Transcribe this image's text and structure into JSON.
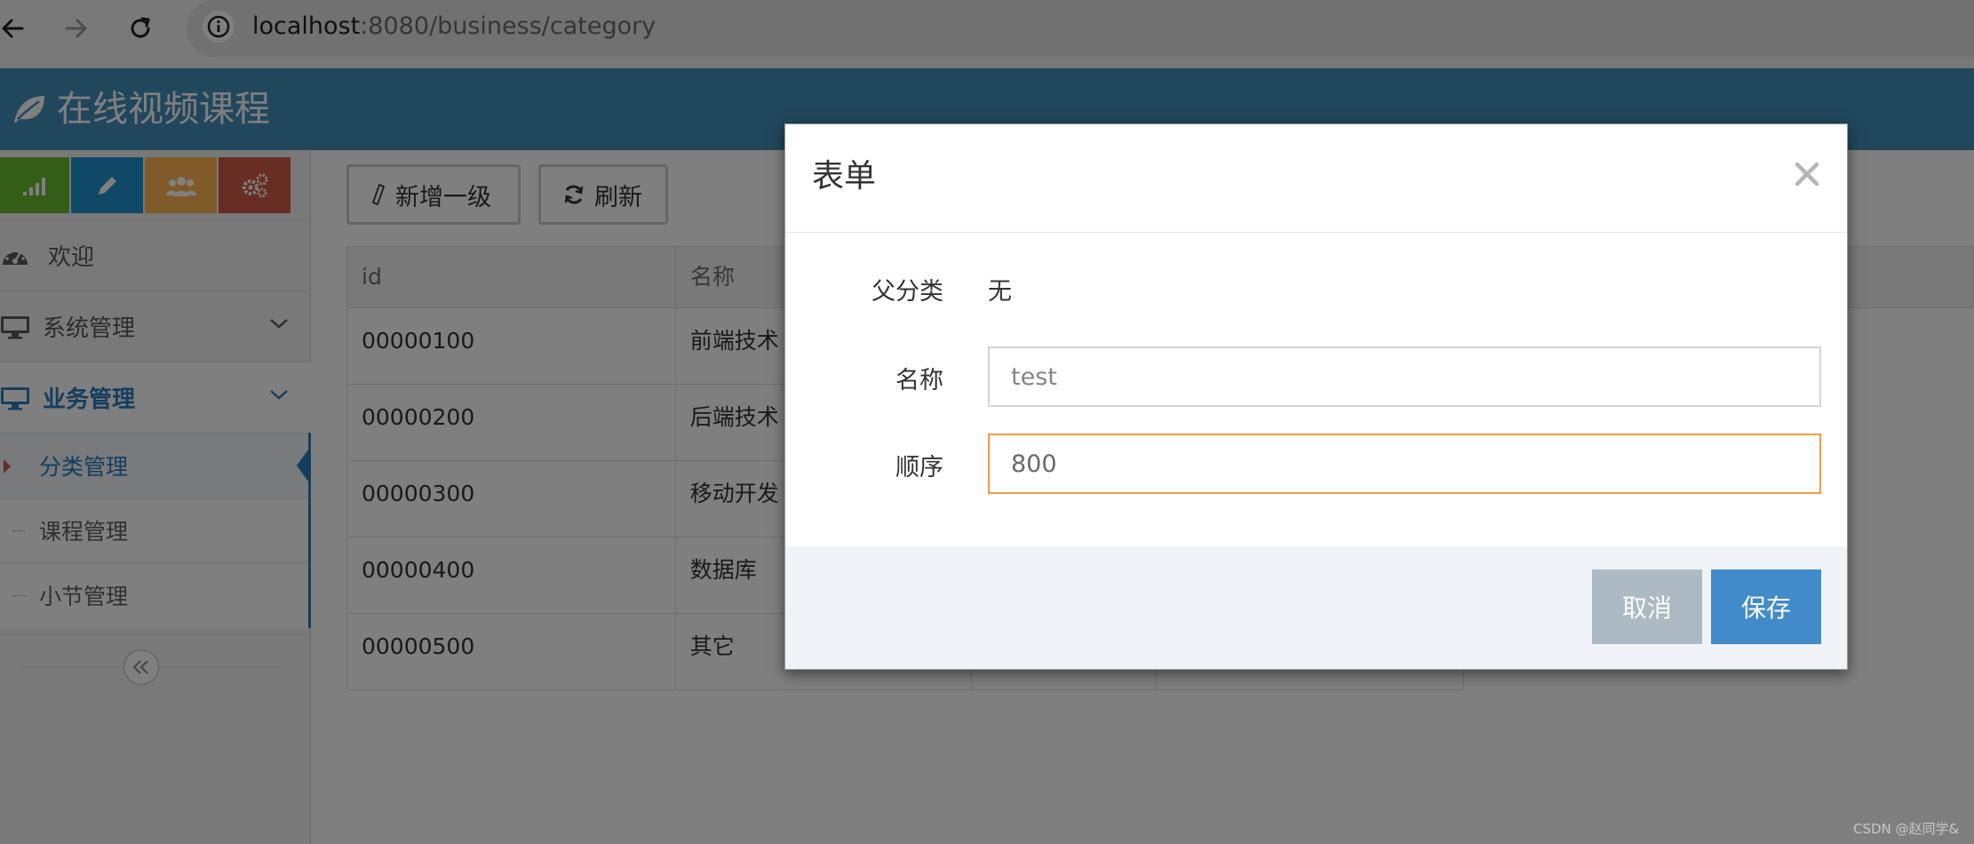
{
  "browser": {
    "url_host": "localhost",
    "url_path": ":8080/business/category"
  },
  "app": {
    "brand": "在线视频课程"
  },
  "sidebar": {
    "shortcuts": [
      {
        "icon": "signal-icon",
        "color": "#68bc31"
      },
      {
        "icon": "pencil-icon",
        "color": "#2091cf"
      },
      {
        "icon": "users-icon",
        "color": "#ffb752"
      },
      {
        "icon": "cogs-icon",
        "color": "#d15b47"
      }
    ],
    "items": [
      {
        "label": "欢迎",
        "icon": "dashboard-icon"
      },
      {
        "label": "系统管理",
        "icon": "desktop-icon"
      },
      {
        "label": "业务管理",
        "icon": "desktop-icon"
      }
    ],
    "subitems": [
      {
        "label": "分类管理"
      },
      {
        "label": "课程管理"
      },
      {
        "label": "小节管理"
      }
    ]
  },
  "toolbar": {
    "add_label": "新增一级",
    "refresh_label": "刷新"
  },
  "table": {
    "headers": [
      "id",
      "名称",
      "",
      ""
    ],
    "rows": [
      [
        "00000100",
        "前端技术"
      ],
      [
        "00000200",
        "后端技术"
      ],
      [
        "00000300",
        "移动开发"
      ],
      [
        "00000400",
        "数据库"
      ],
      [
        "00000500",
        "其它"
      ]
    ]
  },
  "modal": {
    "title": "表单",
    "parent_label": "父分类",
    "parent_value": "无",
    "name_label": "名称",
    "name_value": "test",
    "order_label": "顺序",
    "order_value": "800",
    "cancel_label": "取消",
    "save_label": "保存"
  },
  "watermark": "CSDN @赵同学&"
}
